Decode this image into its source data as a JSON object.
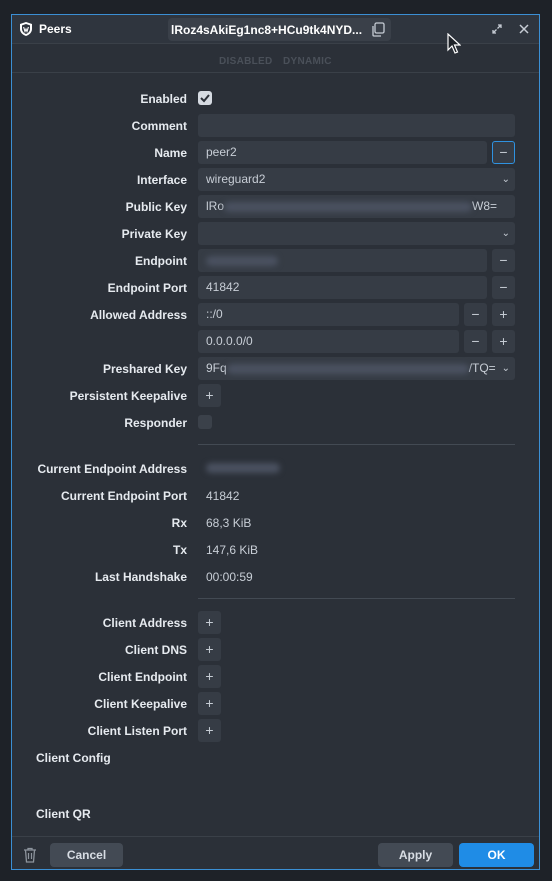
{
  "window": {
    "title": "Peers",
    "peer_id": "lRoz4sAkiEg1nc8+HCu9tk4NYD..."
  },
  "status": {
    "disabled": "DISABLED",
    "dynamic": "DYNAMIC"
  },
  "form": {
    "enabled": {
      "label": "Enabled",
      "checked": true
    },
    "comment": {
      "label": "Comment",
      "value": ""
    },
    "name": {
      "label": "Name",
      "value": "peer2"
    },
    "interface": {
      "label": "Interface",
      "value": "wireguard2"
    },
    "public_key": {
      "label": "Public Key",
      "prefix": "lRo",
      "suffix": "W8="
    },
    "private_key": {
      "label": "Private Key",
      "value": ""
    },
    "endpoint": {
      "label": "Endpoint"
    },
    "endpoint_port": {
      "label": "Endpoint Port",
      "value": "41842"
    },
    "allowed_address": {
      "label": "Allowed Address",
      "values": [
        "::/0",
        "0.0.0.0/0"
      ]
    },
    "preshared_key": {
      "label": "Preshared Key",
      "prefix": "9Fq",
      "suffix": "/TQ="
    },
    "persistent_keepalive": {
      "label": "Persistent Keepalive"
    },
    "responder": {
      "label": "Responder",
      "checked": false
    },
    "current_endpoint_address": {
      "label": "Current Endpoint Address"
    },
    "current_endpoint_port": {
      "label": "Current Endpoint Port",
      "value": "41842"
    },
    "rx": {
      "label": "Rx",
      "value": "68,3 KiB"
    },
    "tx": {
      "label": "Tx",
      "value": "147,6 KiB"
    },
    "last_handshake": {
      "label": "Last Handshake",
      "value": "00:00:59"
    },
    "client_address": {
      "label": "Client Address"
    },
    "client_dns": {
      "label": "Client DNS"
    },
    "client_endpoint": {
      "label": "Client Endpoint"
    },
    "client_keepalive": {
      "label": "Client Keepalive"
    },
    "client_listen_port": {
      "label": "Client Listen Port"
    },
    "client_config": {
      "label": "Client Config"
    },
    "client_qr": {
      "label": "Client QR"
    }
  },
  "footer": {
    "cancel": "Cancel",
    "apply": "Apply",
    "ok": "OK"
  },
  "icons": {
    "app": "shield-icon",
    "copy": "copy-icon",
    "restore": "restore-icon",
    "close": "close-icon",
    "minus": "minus-icon",
    "plus": "plus-icon",
    "chevron": "chevron-down-icon",
    "trash": "trash-icon",
    "check": "check-icon"
  },
  "colors": {
    "accent": "#1f8ce6",
    "background": "#2b3038",
    "field": "#363c45"
  }
}
